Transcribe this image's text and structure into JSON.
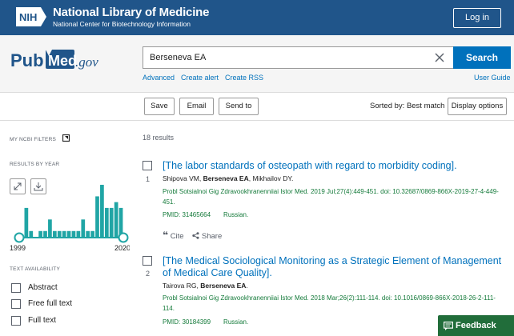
{
  "header": {
    "nih": "NIH",
    "title": "National Library of Medicine",
    "subtitle": "National Center for Biotechnology Information",
    "login": "Log in"
  },
  "search": {
    "logo_pub": "Pub",
    "logo_med": "Med",
    "logo_gov": ".gov",
    "value": "Berseneva EA",
    "button": "Search",
    "links": [
      "Advanced",
      "Create alert",
      "Create RSS"
    ],
    "user_guide": "User Guide"
  },
  "toolbar": {
    "save": "Save",
    "email": "Email",
    "send_to": "Send to",
    "sorted_by": "Sorted by: Best match",
    "display_options": "Display options"
  },
  "sidebar": {
    "my_filters": "MY NCBI FILTERS",
    "results_by_year": "RESULTS BY YEAR",
    "year_start": "1999",
    "year_end": "2020",
    "text_availability": "TEXT AVAILABILITY",
    "filters": [
      "Abstract",
      "Free full text",
      "Full text"
    ]
  },
  "chart_data": {
    "type": "bar",
    "x": [
      1999,
      2000,
      2001,
      2002,
      2003,
      2004,
      2005,
      2006,
      2007,
      2008,
      2009,
      2010,
      2011,
      2012,
      2013,
      2014,
      2015,
      2016,
      2017,
      2018,
      2019,
      2020
    ],
    "values": [
      0,
      5,
      1,
      0,
      1,
      1,
      3,
      1,
      1,
      1,
      1,
      1,
      1,
      3,
      1,
      1,
      7,
      9,
      5,
      5,
      6,
      5
    ]
  },
  "results": {
    "count": "18 results",
    "items": [
      {
        "num": "1",
        "title": "[The labor standards of osteopath with regard to morbidity coding].",
        "authors_pre": "Shipova VM, ",
        "authors_bold": "Berseneva EA",
        "authors_post": ", Mikhailov DY.",
        "citation": "Probl Sotsialnoi Gig Zdravookhranenniiai Istor Med. 2019 Jul;27(4):449-451. doi: 10.32687/0869-866X-2019-27-4-449-451.",
        "pmid": "PMID: 31465664",
        "lang": "Russian."
      },
      {
        "num": "2",
        "title": "[The Medical Sociological Monitoring as a Strategic Element of Management of Medical Care Quality].",
        "authors_pre": "Tairova RG, ",
        "authors_bold": "Berseneva EA",
        "authors_post": ".",
        "citation": "Probl Sotsialnoi Gig Zdravookhranenniiai Istor Med. 2018 Mar;26(2):111-114. doi: 10.1016/0869-866X-2018-26-2-111-114.",
        "pmid": "PMID: 30184399",
        "lang": "Russian."
      }
    ],
    "cite": "Cite",
    "share": "Share"
  },
  "feedback": "Feedback",
  "colors": {
    "ncbi_blue": "#20558a",
    "pubmed_blue": "#0071bc",
    "chart_teal": "#20a5a5",
    "feedback_green": "#216d3a"
  }
}
